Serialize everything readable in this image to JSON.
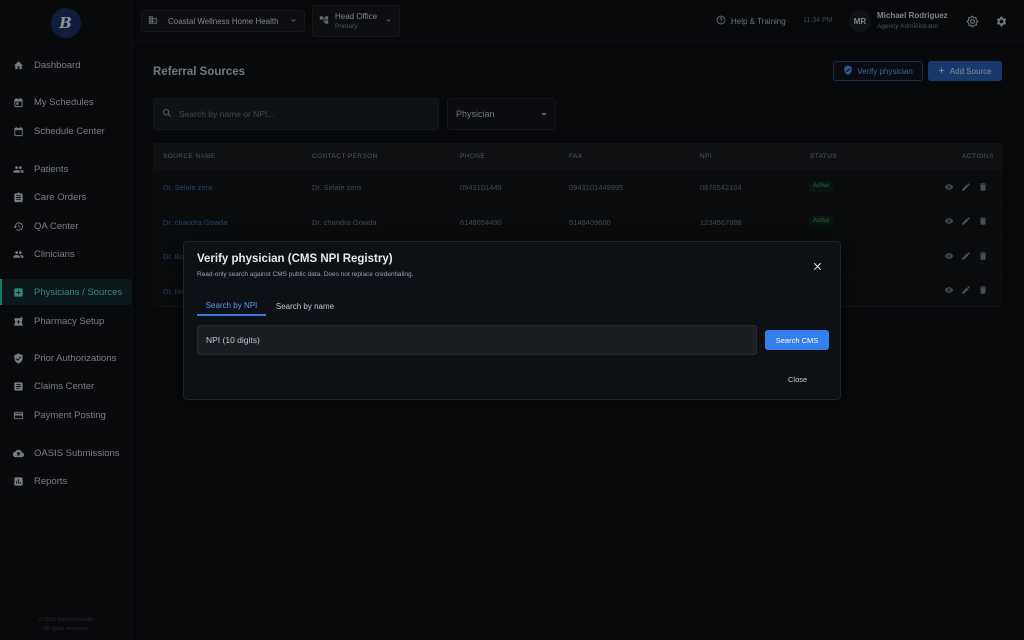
{
  "app": {
    "logo_letter": "B"
  },
  "sidebar": {
    "items": [
      {
        "label": "Dashboard",
        "icon": "home-icon"
      },
      {
        "label": "My Schedules",
        "icon": "calendar-icon"
      },
      {
        "label": "Schedule Center",
        "icon": "calendar-icon"
      },
      {
        "label": "Patients",
        "icon": "people-icon"
      },
      {
        "label": "Care Orders",
        "icon": "clipboard-icon"
      },
      {
        "label": "QA Center",
        "icon": "history-icon"
      },
      {
        "label": "Clinicians",
        "icon": "people-icon"
      },
      {
        "label": "Physicians / Sources",
        "icon": "plus-box-icon",
        "active": true
      },
      {
        "label": "Pharmacy Setup",
        "icon": "pharmacy-icon"
      },
      {
        "label": "Prior Authorizations",
        "icon": "shield-icon"
      },
      {
        "label": "Claims Center",
        "icon": "document-icon"
      },
      {
        "label": "Payment Posting",
        "icon": "card-icon"
      },
      {
        "label": "OASIS Submissions",
        "icon": "cloud-upload-icon"
      },
      {
        "label": "Reports",
        "icon": "bar-chart-icon"
      }
    ],
    "footer_line1": "© 2025 Brittany Health",
    "footer_line2": "All rights reserved."
  },
  "topbar": {
    "agency": "Coastal Wellness Home Health",
    "office_name": "Head Office",
    "office_sub": "Primary",
    "help": "Help & Training",
    "time": "11:34 PM",
    "user_initials": "MR",
    "user_name": "Michael Rodriguez",
    "user_role": "Agency Administrator"
  },
  "page": {
    "title": "Referral Sources",
    "verify_button": "Verify physician",
    "add_button": "Add Source",
    "search_placeholder": "Search by name or NPI...",
    "type_filter": "Physician"
  },
  "table": {
    "headers": [
      "SOURCE NAME",
      "CONTACT PERSON",
      "PHONE",
      "FAX",
      "NPI",
      "STATUS",
      "ACTIONS"
    ],
    "rows": [
      {
        "name": "Dr. Selale zera",
        "contact": "Dr. Selale zera",
        "phone": "0943101449",
        "fax": "0943101449995",
        "npi": "0876542104",
        "status": "Active"
      },
      {
        "name": "Dr. chandra Gowda",
        "contact": "Dr. chandra Gowda",
        "phone": "6148054490",
        "fax": "6148409600",
        "npi": "1234567888",
        "status": "Active"
      },
      {
        "name": "Dr. Bo",
        "contact": "",
        "phone": "",
        "fax": "",
        "npi": "",
        "status": ""
      },
      {
        "name": "Dr. Ne",
        "contact": "",
        "phone": "",
        "fax": "",
        "npi": "",
        "status": ""
      }
    ]
  },
  "modal": {
    "title": "Verify physician (CMS NPI Registry)",
    "subtitle": "Read-only search against CMS public data. Does not replace credentialing.",
    "tabs": [
      "Search by NPI",
      "Search by name"
    ],
    "npi_placeholder": "NPI (10 digits)",
    "search_button": "Search CMS",
    "close_button": "Close"
  },
  "colors": {
    "accent": "#2cc7a8",
    "primary": "#3380ec",
    "active_badge": "#3aa86a"
  }
}
